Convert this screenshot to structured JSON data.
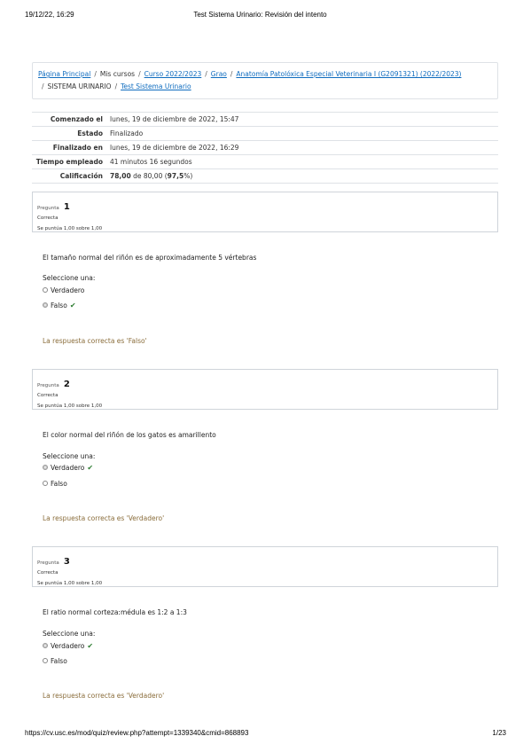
{
  "print_header": {
    "datetime": "19/12/22, 16:29",
    "title": "Test Sistema Urinario: Revisión del intento"
  },
  "print_footer": {
    "url": "https://cv.usc.es/mod/quiz/review.php?attempt=1339340&cmid=868893",
    "page": "1/23"
  },
  "breadcrumb": {
    "items": [
      {
        "label": "Página Principal",
        "link": true
      },
      {
        "label": "Mis cursos",
        "link": false
      },
      {
        "label": "Curso 2022/2023",
        "link": true
      },
      {
        "label": "Grao",
        "link": true
      },
      {
        "label": "Anatomía Patolóxica Especial Veterinaria I (G2091321) (2022/2023)",
        "link": true
      },
      {
        "label": "SISTEMA URINARIO",
        "link": false
      },
      {
        "label": "Test Sistema Urinario",
        "link": true
      }
    ],
    "separator": "/"
  },
  "summary": {
    "rows": [
      {
        "label": "Comenzado el",
        "value": "lunes, 19 de diciembre de 2022, 15:47"
      },
      {
        "label": "Estado",
        "value": "Finalizado"
      },
      {
        "label": "Finalizado en",
        "value": "lunes, 19 de diciembre de 2022, 16:29"
      },
      {
        "label": "Tiempo empleado",
        "value": "41 minutos 16 segundos"
      }
    ],
    "grade_label": "Calificación",
    "grade_score": "78,00",
    "grade_mid": " de 80,00 (",
    "grade_percent": "97,5",
    "grade_end": "%)"
  },
  "questions": [
    {
      "number_label": "Pregunta",
      "number": "1",
      "state": "Correcta",
      "grade": "Se puntúa 1,00 sobre 1,00",
      "text": "El tamaño normal del riñón es de aproximadamente 5 vértebras",
      "prompt": "Seleccione una:",
      "options": [
        "Verdadero",
        "Falso"
      ],
      "selected": 1,
      "feedback": "La respuesta correcta es 'Falso'"
    },
    {
      "number_label": "Pregunta",
      "number": "2",
      "state": "Correcta",
      "grade": "Se puntúa 1,00 sobre 1,00",
      "text": "El color normal del riñón de los gatos es amarillento",
      "prompt": "Seleccione una:",
      "options": [
        "Verdadero",
        "Falso"
      ],
      "selected": 0,
      "feedback": "La respuesta correcta es 'Verdadero'"
    },
    {
      "number_label": "Pregunta",
      "number": "3",
      "state": "Correcta",
      "grade": "Se puntúa 1,00 sobre 1,00",
      "text": "El ratio normal corteza:médula es 1:2 a 1:3",
      "prompt": "Seleccione una:",
      "options": [
        "Verdadero",
        "Falso"
      ],
      "selected": 0,
      "feedback": "La respuesta correcta es 'Verdadero'"
    }
  ],
  "colors": {
    "link": "#0f6cbf",
    "check": "#2e7d32",
    "feedback": "#8a6d3b"
  },
  "icons": {
    "check": "check-icon",
    "radio": "radio-icon"
  }
}
